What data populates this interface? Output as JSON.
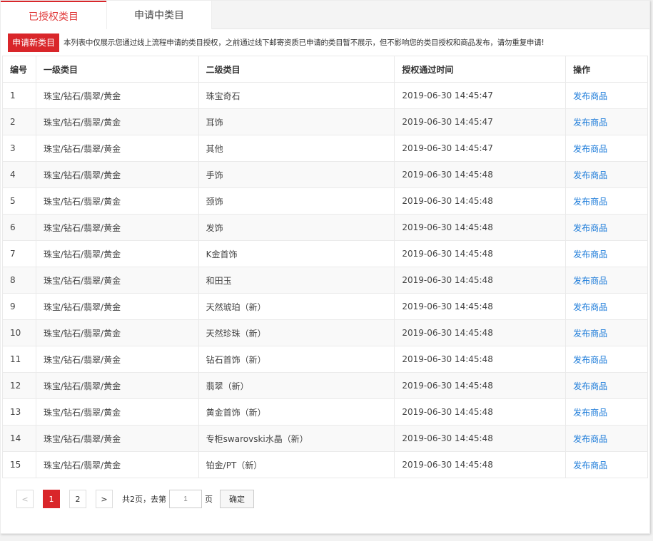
{
  "tabs": [
    {
      "label": "已授权类目",
      "active": true
    },
    {
      "label": "申请中类目",
      "active": false
    }
  ],
  "notice": {
    "apply_label": "申请新类目",
    "text": "本列表中仅展示您通过线上流程申请的类目授权，之前通过线下邮寄资质已申请的类目暂不展示，但不影响您的类目授权和商品发布，请勿重复申请!"
  },
  "table": {
    "headers": [
      "编号",
      "一级类目",
      "二级类目",
      "授权通过时间",
      "操作"
    ],
    "rows": [
      {
        "id": "1",
        "cat1": "珠宝/钻石/翡翠/黄金",
        "cat2": "珠宝奇石",
        "time": "2019-06-30 14:45:47",
        "action": "发布商品"
      },
      {
        "id": "2",
        "cat1": "珠宝/钻石/翡翠/黄金",
        "cat2": "耳饰",
        "time": "2019-06-30 14:45:47",
        "action": "发布商品"
      },
      {
        "id": "3",
        "cat1": "珠宝/钻石/翡翠/黄金",
        "cat2": "其他",
        "time": "2019-06-30 14:45:47",
        "action": "发布商品"
      },
      {
        "id": "4",
        "cat1": "珠宝/钻石/翡翠/黄金",
        "cat2": "手饰",
        "time": "2019-06-30 14:45:48",
        "action": "发布商品"
      },
      {
        "id": "5",
        "cat1": "珠宝/钻石/翡翠/黄金",
        "cat2": "颈饰",
        "time": "2019-06-30 14:45:48",
        "action": "发布商品"
      },
      {
        "id": "6",
        "cat1": "珠宝/钻石/翡翠/黄金",
        "cat2": "发饰",
        "time": "2019-06-30 14:45:48",
        "action": "发布商品"
      },
      {
        "id": "7",
        "cat1": "珠宝/钻石/翡翠/黄金",
        "cat2": "K金首饰",
        "time": "2019-06-30 14:45:48",
        "action": "发布商品"
      },
      {
        "id": "8",
        "cat1": "珠宝/钻石/翡翠/黄金",
        "cat2": "和田玉",
        "time": "2019-06-30 14:45:48",
        "action": "发布商品"
      },
      {
        "id": "9",
        "cat1": "珠宝/钻石/翡翠/黄金",
        "cat2": "天然琥珀（新）",
        "time": "2019-06-30 14:45:48",
        "action": "发布商品"
      },
      {
        "id": "10",
        "cat1": "珠宝/钻石/翡翠/黄金",
        "cat2": "天然珍珠（新）",
        "time": "2019-06-30 14:45:48",
        "action": "发布商品"
      },
      {
        "id": "11",
        "cat1": "珠宝/钻石/翡翠/黄金",
        "cat2": "钻石首饰（新）",
        "time": "2019-06-30 14:45:48",
        "action": "发布商品"
      },
      {
        "id": "12",
        "cat1": "珠宝/钻石/翡翠/黄金",
        "cat2": "翡翠（新）",
        "time": "2019-06-30 14:45:48",
        "action": "发布商品"
      },
      {
        "id": "13",
        "cat1": "珠宝/钻石/翡翠/黄金",
        "cat2": "黄金首饰（新）",
        "time": "2019-06-30 14:45:48",
        "action": "发布商品"
      },
      {
        "id": "14",
        "cat1": "珠宝/钻石/翡翠/黄金",
        "cat2": "专柜swarovski水晶（新）",
        "time": "2019-06-30 14:45:48",
        "action": "发布商品"
      },
      {
        "id": "15",
        "cat1": "珠宝/钻石/翡翠/黄金",
        "cat2": "铂金/PT（新）",
        "time": "2019-06-30 14:45:48",
        "action": "发布商品"
      }
    ]
  },
  "pager": {
    "prev": "<",
    "pages": [
      "1",
      "2"
    ],
    "current": "1",
    "next": ">",
    "total_text": "共2页，去第",
    "input_value": "1",
    "page_suffix": "页",
    "confirm_label": "确定"
  },
  "colors": {
    "accent": "#d9262a",
    "link": "#1a7ad9"
  }
}
